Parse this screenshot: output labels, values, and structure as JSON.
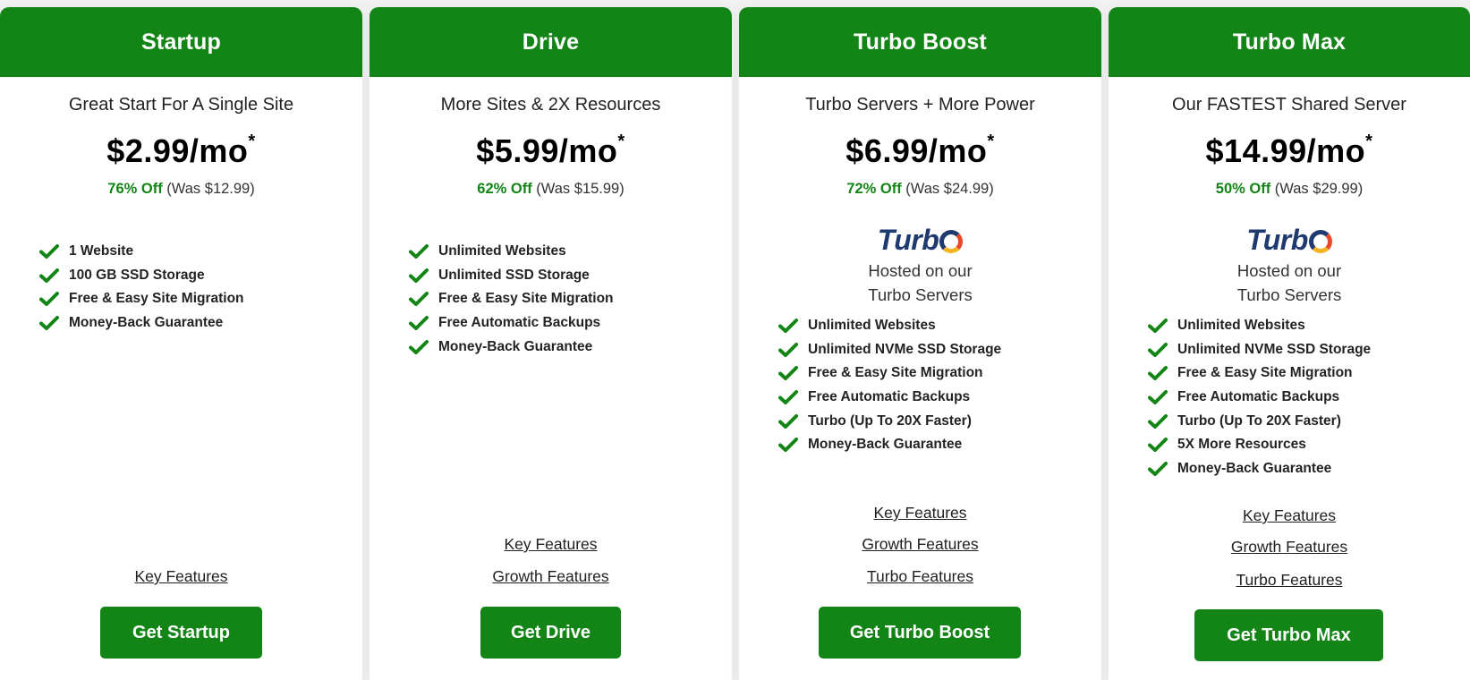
{
  "brand": {
    "accent": "#138516",
    "logo_navy": "#1e3a6e"
  },
  "plans": [
    {
      "name": "Startup",
      "tagline": "Great Start For A Single Site",
      "price": "$2.99/mo",
      "price_mark": "*",
      "discount": "76% Off",
      "was": "(Was $12.99)",
      "features": [
        "1 Website",
        "100 GB SSD Storage",
        "Free & Easy Site Migration",
        "Money-Back Guarantee"
      ],
      "links": [
        "Key Features"
      ],
      "cta": "Get Startup"
    },
    {
      "name": "Drive",
      "tagline": "More Sites & 2X Resources",
      "price": "$5.99/mo",
      "price_mark": "*",
      "discount": "62% Off",
      "was": "(Was $15.99)",
      "features": [
        "Unlimited Websites",
        "Unlimited SSD Storage",
        "Free & Easy Site Migration",
        "Free Automatic Backups",
        "Money-Back Guarantee"
      ],
      "links": [
        "Key Features",
        "Growth Features"
      ],
      "cta": "Get Drive"
    },
    {
      "name": "Turbo Boost",
      "tagline": "Turbo Servers + More Power",
      "price": "$6.99/mo",
      "price_mark": "*",
      "discount": "72% Off",
      "was": "(Was $24.99)",
      "turbo_logo": "Turb",
      "hosted_line1": "Hosted on our",
      "hosted_line2": "Turbo Servers",
      "features": [
        "Unlimited Websites",
        "Unlimited NVMe SSD Storage",
        "Free & Easy Site Migration",
        "Free Automatic Backups",
        "Turbo (Up To 20X Faster)",
        "Money-Back Guarantee"
      ],
      "links": [
        "Key Features",
        "Growth Features",
        "Turbo Features"
      ],
      "cta": "Get Turbo Boost"
    },
    {
      "name": "Turbo Max",
      "tagline": "Our FASTEST Shared Server",
      "price": "$14.99/mo",
      "price_mark": "*",
      "discount": "50% Off",
      "was": "(Was $29.99)",
      "turbo_logo": "Turb",
      "hosted_line1": "Hosted on our",
      "hosted_line2": "Turbo Servers",
      "features": [
        "Unlimited Websites",
        "Unlimited NVMe SSD Storage",
        "Free & Easy Site Migration",
        "Free Automatic Backups",
        "Turbo (Up To 20X Faster)",
        "5X More Resources",
        "Money-Back Guarantee"
      ],
      "links": [
        "Key Features",
        "Growth Features",
        "Turbo Features"
      ],
      "cta": "Get Turbo Max"
    }
  ]
}
